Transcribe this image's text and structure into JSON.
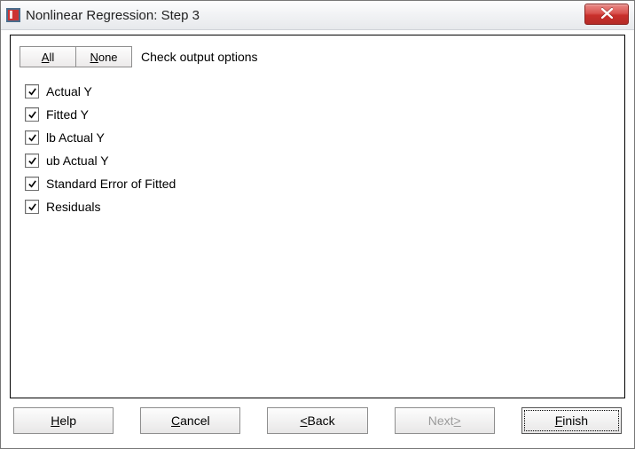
{
  "window": {
    "title": "Nonlinear Regression: Step 3"
  },
  "toolbar": {
    "all_label": "All",
    "all_hotkey": "A",
    "none_label": "None",
    "none_hotkey": "N",
    "caption": "Check output options"
  },
  "options": [
    {
      "label": "Actual Y",
      "checked": true
    },
    {
      "label": "Fitted Y",
      "checked": true
    },
    {
      "label": "lb Actual Y",
      "checked": true
    },
    {
      "label": "ub Actual Y",
      "checked": true
    },
    {
      "label": "Standard Error of Fitted",
      "checked": true
    },
    {
      "label": "Residuals",
      "checked": true
    }
  ],
  "buttons": {
    "help": {
      "label": "Help",
      "hotkey": "H",
      "enabled": true,
      "default": false
    },
    "cancel": {
      "label": "Cancel",
      "hotkey": "C",
      "enabled": true,
      "default": false
    },
    "back": {
      "label": "< Back",
      "hotkey": "<",
      "enabled": true,
      "default": false
    },
    "next": {
      "label": "Next >",
      "hotkey": ">",
      "enabled": false,
      "default": false
    },
    "finish": {
      "label": "Finish",
      "hotkey": "F",
      "enabled": true,
      "default": true
    }
  }
}
